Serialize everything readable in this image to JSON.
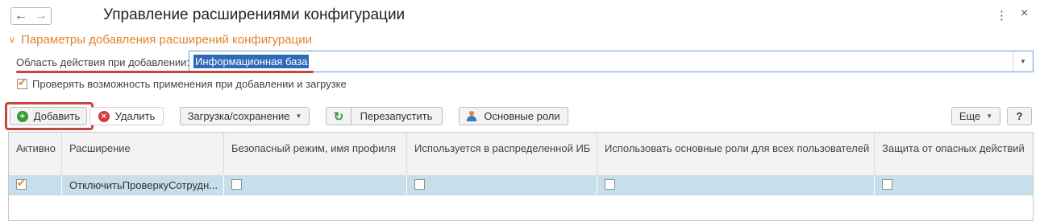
{
  "window": {
    "title": "Управление расширениями конфигурации",
    "nav": {
      "back_icon": "←",
      "forward_icon": "→"
    },
    "more_icon": "⋮",
    "close_icon": "×"
  },
  "section": {
    "title": "Параметры добавления расширений конфигурации",
    "field_label": "Область действия при добавлении:",
    "field_value": "Информационная база",
    "checkbox_label": "Проверять возможность применения при добавлении и загрузке",
    "checkbox_checked": true
  },
  "toolbar": {
    "add_label": "Добавить",
    "delete_label": "Удалить",
    "load_save_label": "Загрузка/сохранение",
    "restart_label": "Перезапустить",
    "roles_label": "Основные роли",
    "more_label": "Еще",
    "help_label": "?"
  },
  "table": {
    "columns": [
      "Активно",
      "Расширение",
      "Безопасный режим, имя профиля",
      "Используется в распределенной ИБ",
      "Использовать основные роли для всех пользователей",
      "Защита от опасных действий"
    ],
    "rows": [
      {
        "active": true,
        "extension": "ОтключитьПроверкуСотрудн...",
        "safe_mode": false,
        "distributed": false,
        "main_roles_all": false,
        "danger_protection": false
      }
    ]
  },
  "colors": {
    "accent_orange": "#e4832c",
    "highlight_red": "#c6463e",
    "selection_blue": "#2f6bb8",
    "row_selected": "#c7dfea"
  }
}
